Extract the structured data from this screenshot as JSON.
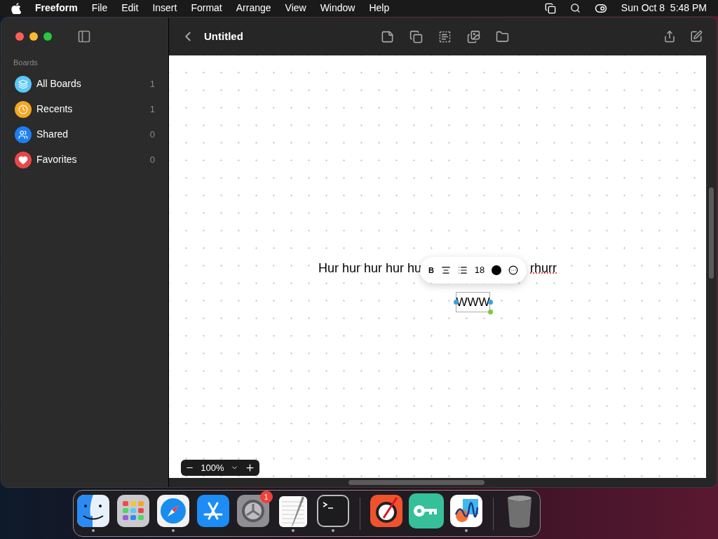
{
  "menu_bar": {
    "app": "Freeform",
    "menus": [
      "File",
      "Edit",
      "Insert",
      "Format",
      "Arrange",
      "View",
      "Window",
      "Help"
    ],
    "clock": "Sun Oct 8  5:48 PM"
  },
  "window": {
    "title": "Untitled"
  },
  "sidebar": {
    "heading": "Boards",
    "items": [
      {
        "label": "All Boards",
        "count": "1",
        "color": "#5ac8fa",
        "kind": "boards"
      },
      {
        "label": "Recents",
        "count": "1",
        "color": "#f5a623",
        "kind": "clock"
      },
      {
        "label": "Shared",
        "count": "0",
        "color": "#1e7ff0",
        "kind": "people"
      },
      {
        "label": "Favorites",
        "count": "0",
        "color": "#e8474a",
        "kind": "heart"
      }
    ]
  },
  "canvas": {
    "text_visible_left": "Hur hur hur hur hu",
    "text_visible_right": "rhurr",
    "text_box": {
      "value": "WWW",
      "selected": true
    },
    "format_toolbar": {
      "bold_label": "B",
      "font_size": "18"
    },
    "zoom": "100%"
  },
  "dock": [
    {
      "kind": "finder",
      "running": true
    },
    {
      "kind": "launchpad",
      "running": false
    },
    {
      "kind": "safari",
      "running": true
    },
    {
      "kind": "appstore",
      "running": false
    },
    {
      "kind": "settings",
      "running": false,
      "badge": "1"
    },
    {
      "kind": "textedit",
      "running": true
    },
    {
      "kind": "terminal",
      "running": true
    },
    {
      "kind": "divider"
    },
    {
      "kind": "colorpicker",
      "running": false
    },
    {
      "kind": "keyapp",
      "running": false
    },
    {
      "kind": "freeform",
      "running": true
    },
    {
      "kind": "divider"
    },
    {
      "kind": "trash",
      "running": false
    }
  ]
}
